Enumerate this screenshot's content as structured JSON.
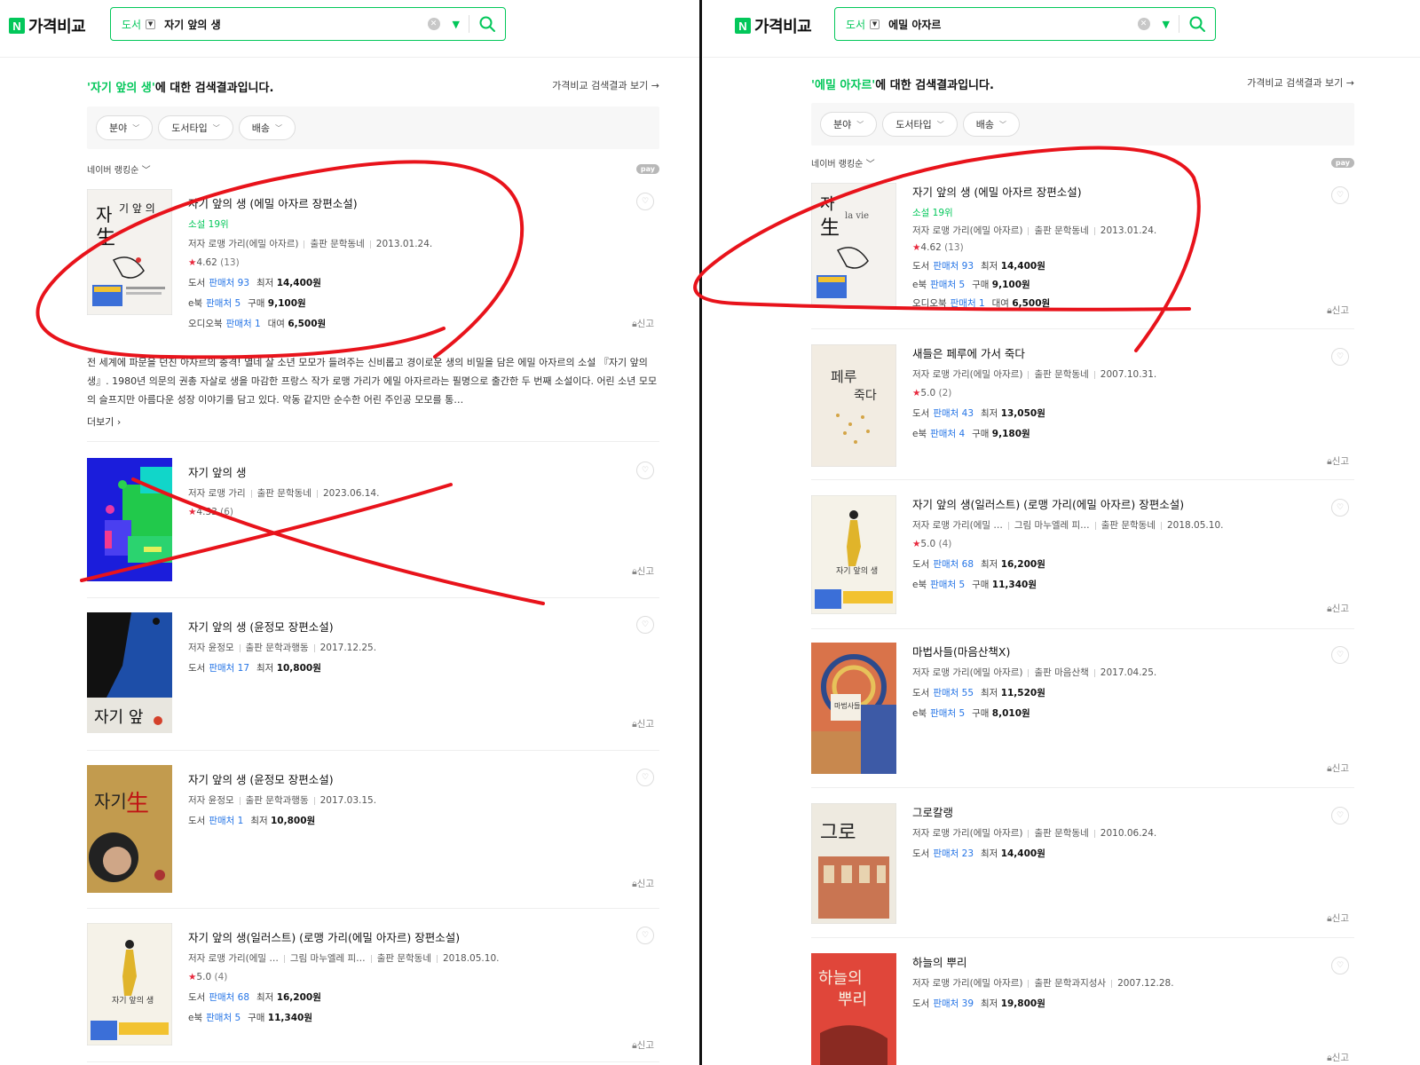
{
  "colors": {
    "brand_green": "#03c75a",
    "link_blue": "#2474e6",
    "star_red": "#e8283d",
    "annotation_red": "#e8131b"
  },
  "left": {
    "logo": {
      "n": "N",
      "text": "가격비교"
    },
    "search": {
      "category": "도서",
      "query": "자기 앞의 생"
    },
    "result_head": {
      "query": "'자기 앞의 생'",
      "suffix": "에 대한 검색결과입니다.",
      "link": "가격비교 검색결과 보기 →"
    },
    "filters": [
      "분야",
      "도서타입",
      "배송"
    ],
    "sort": "네이버 랭킹순",
    "npay": "pay",
    "items": [
      {
        "title": "자기 앞의 생 (에밀 아자르 장편소설)",
        "rank": "소설 19위",
        "author": "저자 로맹 가리(에밀 아자르)",
        "publisher": "출판 문학동네",
        "date": "2013.01.24.",
        "rating": "4.62",
        "rating_count": "(13)",
        "prices": [
          {
            "type": "도서",
            "sellers": "판매처 93",
            "label": "최저",
            "amount": "14,400원"
          },
          {
            "type": "e북",
            "sellers": "판매처 5",
            "label": "구매",
            "amount": "9,100원"
          },
          {
            "type": "오디오북",
            "sellers": "판매처 1",
            "label": "대여",
            "amount": "6,500원"
          }
        ],
        "report": "신고",
        "description": "전 세계에 파문을 던진 아자르의 충격! 열네 살 소년 모모가 들려주는 신비롭고 경이로운 생의 비밀을 담은 에밀 아자르의 소설 『자기 앞의 생』. 1980년 의문의 권총 자살로 생을 마감한 프랑스 작가 로맹 가리가 에밀 아자르라는 필명으로 출간한 두 번째 소설이다. 어린 소년 모모의 슬프지만 아름다운 성장 이야기를 담고 있다. 악동 같지만 순수한 어린 주인공 모모를 통…",
        "more": "더보기 ›"
      },
      {
        "title": "자기 앞의 생",
        "author": "저자 로맹 가리",
        "publisher": "출판 문학동네",
        "date": "2023.06.14.",
        "rating": "4.33",
        "rating_count": "(6)",
        "report": "신고"
      },
      {
        "title": "자기 앞의 생 (윤정모 장편소설)",
        "author": "저자 윤정모",
        "publisher": "출판 문학과행동",
        "date": "2017.12.25.",
        "prices": [
          {
            "type": "도서",
            "sellers": "판매처 17",
            "label": "최저",
            "amount": "10,800원"
          }
        ],
        "report": "신고"
      },
      {
        "title": "자기 앞의 생 (윤정모 장편소설)",
        "author": "저자 윤정모",
        "publisher": "출판 문학과행동",
        "date": "2017.03.15.",
        "prices": [
          {
            "type": "도서",
            "sellers": "판매처 1",
            "label": "최저",
            "amount": "10,800원"
          }
        ],
        "report": "신고"
      },
      {
        "title": "자기 앞의 생(일러스트) (로맹 가리(에밀 아자르) 장편소설)",
        "author": "저자 로맹 가리(에밀 …",
        "illustrator": "그림 마누엘레 피…",
        "publisher": "출판 문학동네",
        "date": "2018.05.10.",
        "rating": "5.0",
        "rating_count": "(4)",
        "prices": [
          {
            "type": "도서",
            "sellers": "판매처 68",
            "label": "최저",
            "amount": "16,200원"
          },
          {
            "type": "e북",
            "sellers": "판매처 5",
            "label": "구매",
            "amount": "11,340원"
          }
        ],
        "report": "신고"
      }
    ]
  },
  "right": {
    "logo": {
      "n": "N",
      "text": "가격비교"
    },
    "search": {
      "category": "도서",
      "query": "에밀 아자르"
    },
    "result_head": {
      "query": "'에밀 아자르'",
      "suffix": "에 대한 검색결과입니다.",
      "link": "가격비교 검색결과 보기 →"
    },
    "filters": [
      "분야",
      "도서타입",
      "배송"
    ],
    "sort": "네이버 랭킹순",
    "npay": "pay",
    "items": [
      {
        "title": "자기 앞의 생 (에밀 아자르 장편소설)",
        "rank": "소설 19위",
        "author": "저자 로맹 가리(에밀 아자르)",
        "publisher": "출판 문학동네",
        "date": "2013.01.24.",
        "rating": "4.62",
        "rating_count": "(13)",
        "prices": [
          {
            "type": "도서",
            "sellers": "판매처 93",
            "label": "최저",
            "amount": "14,400원"
          },
          {
            "type": "e북",
            "sellers": "판매처 5",
            "label": "구매",
            "amount": "9,100원"
          },
          {
            "type": "오디오북",
            "sellers": "판매처 1",
            "label": "대여",
            "amount": "6,500원"
          }
        ],
        "report": "신고"
      },
      {
        "title": "새들은 페루에 가서 죽다",
        "author": "저자 로맹 가리(에밀 아자르)",
        "publisher": "출판 문학동네",
        "date": "2007.10.31.",
        "rating": "5.0",
        "rating_count": "(2)",
        "prices": [
          {
            "type": "도서",
            "sellers": "판매처 43",
            "label": "최저",
            "amount": "13,050원"
          },
          {
            "type": "e북",
            "sellers": "판매처 4",
            "label": "구매",
            "amount": "9,180원"
          }
        ],
        "report": "신고"
      },
      {
        "title": "자기 앞의 생(일러스트) (로맹 가리(에밀 아자르) 장편소설)",
        "author": "저자 로맹 가리(에밀 …",
        "illustrator": "그림 마누엘레 피…",
        "publisher": "출판 문학동네",
        "date": "2018.05.10.",
        "rating": "5.0",
        "rating_count": "(4)",
        "prices": [
          {
            "type": "도서",
            "sellers": "판매처 68",
            "label": "최저",
            "amount": "16,200원"
          },
          {
            "type": "e북",
            "sellers": "판매처 5",
            "label": "구매",
            "amount": "11,340원"
          }
        ],
        "report": "신고"
      },
      {
        "title": "마법사들(마음산책X)",
        "author": "저자 로맹 가리(에밀 아자르)",
        "publisher": "출판 마음산책",
        "date": "2017.04.25.",
        "prices": [
          {
            "type": "도서",
            "sellers": "판매처 55",
            "label": "최저",
            "amount": "11,520원"
          },
          {
            "type": "e북",
            "sellers": "판매처 5",
            "label": "구매",
            "amount": "8,010원"
          }
        ],
        "report": "신고"
      },
      {
        "title": "그로칼랭",
        "author": "저자 로맹 가리(에밀 아자르)",
        "publisher": "출판 문학동네",
        "date": "2010.06.24.",
        "prices": [
          {
            "type": "도서",
            "sellers": "판매처 23",
            "label": "최저",
            "amount": "14,400원"
          }
        ],
        "report": "신고"
      },
      {
        "title": "하늘의 뿌리",
        "author": "저자 로맹 가리(에밀 아자르)",
        "publisher": "출판 문학과지성사",
        "date": "2007.12.28.",
        "prices": [
          {
            "type": "도서",
            "sellers": "판매처 39",
            "label": "최저",
            "amount": "19,800원"
          }
        ],
        "report": "신고"
      }
    ]
  }
}
